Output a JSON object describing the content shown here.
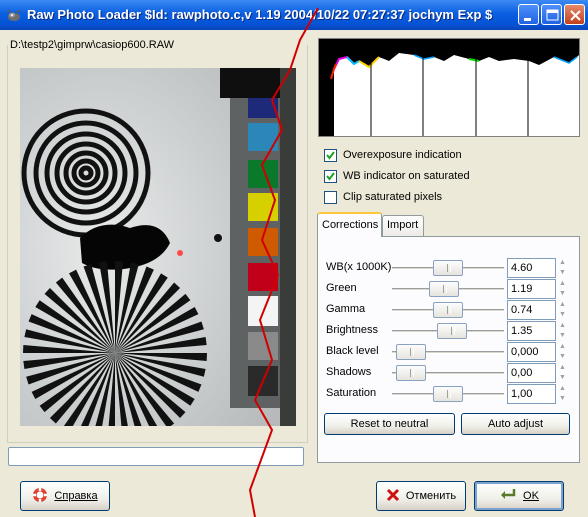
{
  "window": {
    "title": "Raw Photo Loader $Id: rawphoto.c,v 1.19 2004/10/22 07:27:37 jochym Exp $",
    "icon": "gimp-wilber-icon"
  },
  "preview": {
    "file_path": "D:\\testp2\\gimprw\\casiop600.RAW"
  },
  "options": {
    "overexposure": {
      "label": "Overexposure indication",
      "checked": true
    },
    "wb_indicator": {
      "label": "WB indicator on saturated",
      "checked": true
    },
    "clip_saturated": {
      "label": "Clip saturated pixels",
      "checked": false
    }
  },
  "tabs": [
    {
      "label": "Corrections",
      "active": true
    },
    {
      "label": "Import",
      "active": false
    }
  ],
  "sliders": [
    {
      "label": "WB(x 1000K)",
      "value": "4.60",
      "level": 0.5
    },
    {
      "label": "Green",
      "value": "1.19",
      "level": 0.45
    },
    {
      "label": "Gamma",
      "value": "0.74",
      "level": 0.5
    },
    {
      "label": "Brightness",
      "value": "1.35",
      "level": 0.55
    },
    {
      "label": "Black level",
      "value": "0,000",
      "level": 0.05
    },
    {
      "label": "Shadows",
      "value": "0,00",
      "level": 0.05
    },
    {
      "label": "Saturation",
      "value": "1,00",
      "level": 0.5
    }
  ],
  "buttons": {
    "reset": "Reset to neutral",
    "auto": "Auto adjust",
    "help": "Справка",
    "cancel": "Отменить",
    "ok": "OK"
  },
  "colors": {
    "titlebar": "#0a5fe0",
    "red_cut_line": "#d00000",
    "tab_highlight": "#ffc83c"
  }
}
